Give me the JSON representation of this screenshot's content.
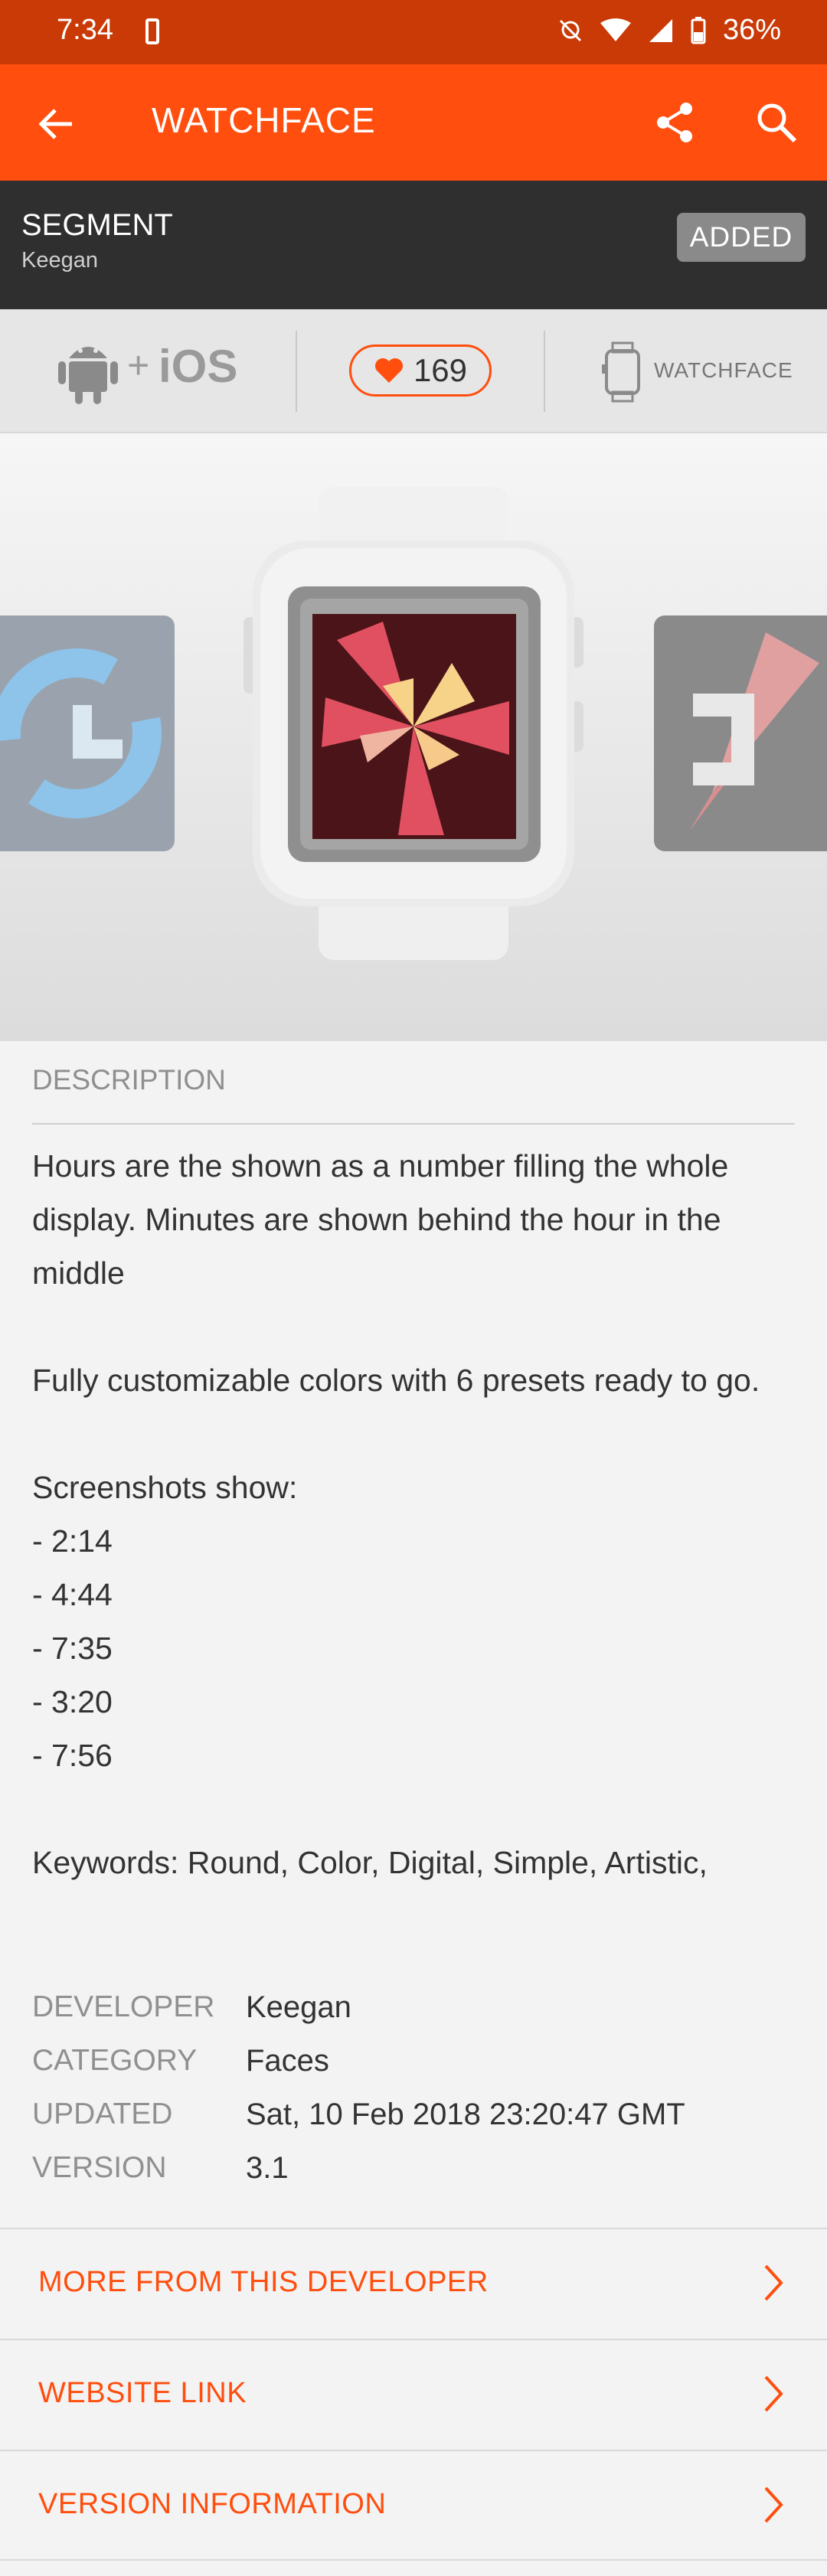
{
  "status": {
    "time": "7:34",
    "battery": "36%"
  },
  "appbar": {
    "title": "WATCHFACE"
  },
  "app": {
    "name": "SEGMENT",
    "author": "Keegan",
    "added_label": "ADDED"
  },
  "platform": {
    "plus": "+",
    "ios": "iOS",
    "likes": "169",
    "type_label": "WATCHFACE"
  },
  "description": {
    "heading": "DESCRIPTION",
    "text": "Hours are the shown as a number filling the whole display. Minutes are shown behind the hour in the middle\n\nFully customizable colors with 6 presets ready to go.\n\nScreenshots show:\n- 2:14\n- 4:44\n- 7:35\n- 3:20\n- 7:56\n\nKeywords: Round, Color, Digital, Simple, Artistic,"
  },
  "meta": {
    "developer_label": "DEVELOPER",
    "developer": "Keegan",
    "category_label": "CATEGORY",
    "category": "Faces",
    "updated_label": "UPDATED",
    "updated": "Sat, 10 Feb 2018 23:20:47 GMT",
    "version_label": "VERSION",
    "version": "3.1"
  },
  "links": {
    "more": "MORE FROM THIS DEVELOPER",
    "website": "WEBSITE LINK",
    "version_info": "VERSION INFORMATION"
  },
  "colors": {
    "accent": "#ff4e0e",
    "statusbar": "#c93a06",
    "infobar": "#2f2f2f"
  }
}
